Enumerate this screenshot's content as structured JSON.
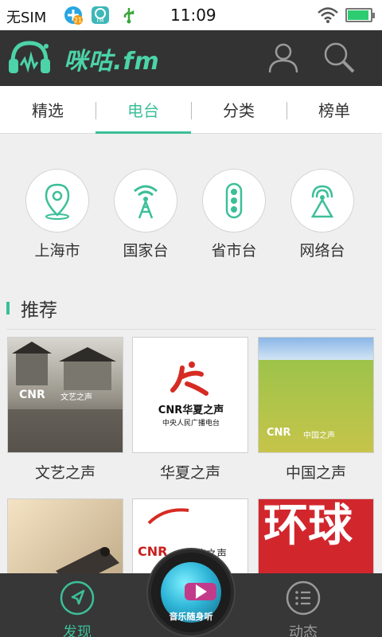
{
  "status_bar": {
    "carrier": "无SIM",
    "time": "11:09",
    "notif_badge": "21",
    "fm_icon_text": "FM",
    "battery_level": 0.85
  },
  "app": {
    "brand": "咪咕.fm",
    "accent_color": "#3cbf98"
  },
  "tabs": [
    {
      "label": "精选"
    },
    {
      "label": "电台"
    },
    {
      "label": "分类"
    },
    {
      "label": "榜单"
    }
  ],
  "active_tab": "电台",
  "categories": [
    {
      "label": "上海市",
      "icon": "location-pin-icon"
    },
    {
      "label": "国家台",
      "icon": "broadcast-tower-icon"
    },
    {
      "label": "省市台",
      "icon": "traffic-light-icon"
    },
    {
      "label": "网络台",
      "icon": "antenna-icon"
    }
  ],
  "recommend": {
    "title": "推荐",
    "items": [
      {
        "name": "文艺之声",
        "logo_text": "CNR",
        "overlay_text": "文艺之声"
      },
      {
        "name": "华夏之声",
        "logo_text": "CNR华夏之声",
        "sub_text": "中央人民广播电台"
      },
      {
        "name": "中国之声",
        "logo_text": "CNR",
        "overlay_text": "中国之声"
      },
      {
        "name": "",
        "logo_text": ""
      },
      {
        "name": "",
        "logo_text": "CNR",
        "overlay_text": "民族之声"
      },
      {
        "name": "",
        "logo_text": "环球"
      }
    ]
  },
  "bottom_nav": {
    "discover": "发现",
    "center": "音乐随身听",
    "activity": "动态"
  }
}
